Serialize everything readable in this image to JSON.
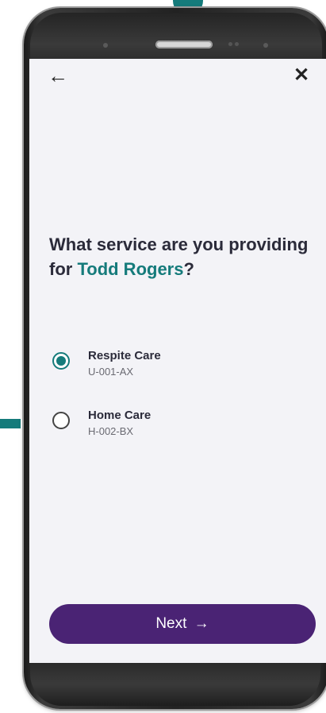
{
  "header": {
    "back_icon": "arrow-left-icon",
    "close_icon": "close-x-icon",
    "back_glyph": "←",
    "close_glyph": "✕"
  },
  "question": {
    "prefix": "What service are you providing for ",
    "client_name": "Todd Rogers",
    "suffix": "?"
  },
  "options": [
    {
      "title": "Respite Care",
      "code": "U-001-AX",
      "selected": true
    },
    {
      "title": "Home Care",
      "code": "H-002-BX",
      "selected": false
    }
  ],
  "next_button": {
    "label": "Next",
    "arrow": "→"
  },
  "colors": {
    "accent": "#157b7b",
    "button": "#4a2374",
    "screen_bg": "#f3f3f7"
  }
}
